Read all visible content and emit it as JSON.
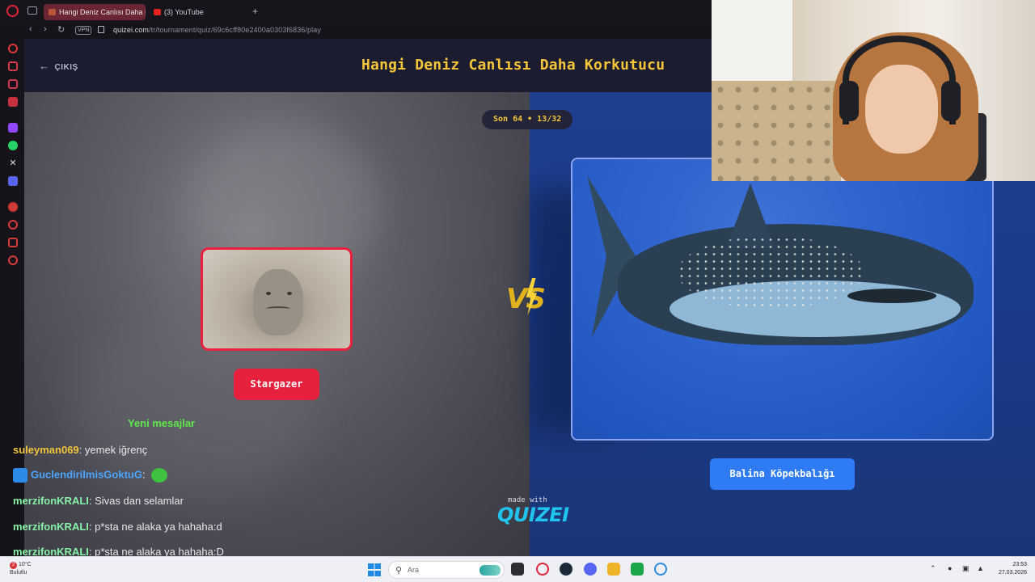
{
  "browser": {
    "tabs": [
      {
        "label": "Hangi Deniz Canlısı Daha K",
        "active": true
      },
      {
        "label": "(3) YouTube",
        "active": false
      }
    ],
    "address": {
      "vpn_label": "VPN",
      "host": "quizei.com",
      "path": "/tr/tournament/quiz/69c6cff80e2400a0303f6836/play"
    }
  },
  "quiz": {
    "exit_label": "ÇIKIŞ",
    "title": "Hangi Deniz Canlısı Daha Korkutucu",
    "round_label": "Son 64 • 13/32",
    "vs_label": "VS",
    "left": {
      "name": "Stargazer"
    },
    "right": {
      "name": "Balina Köpekbalığı"
    },
    "footer": {
      "made_with": "made with",
      "brand": "QUIZEI"
    }
  },
  "chat": {
    "title": "Yeni mesajlar",
    "messages": [
      {
        "user": "suleyman069",
        "color": "#f0c43a",
        "text": "yemek iğrenç"
      },
      {
        "user": "GuclendirilmisGoktuG",
        "color": "#4aa6ff",
        "text": ""
      },
      {
        "user": "merzifonKRALI",
        "color": "#86f2a6",
        "text": "Sivas dan selamlar"
      },
      {
        "user": "merzifonKRALI",
        "color": "#86f2a6",
        "text": "p*sta ne alaka ya hahaha:d"
      },
      {
        "user": "merzifonKRALI",
        "color": "#86f2a6",
        "text": "p*sta ne alaka ya hahaha:D"
      }
    ]
  },
  "taskbar": {
    "weather_temp": "10°C",
    "weather_desc": "Bulutlu",
    "notification_count": "2",
    "search_placeholder": "Ara",
    "time": "23:53",
    "date": "27.03.2026"
  },
  "colors": {
    "accent_red": "#e5213d",
    "accent_blue": "#2f7bf5",
    "title_yellow": "#f5c53a",
    "brand_cyan": "#21c4ef"
  }
}
